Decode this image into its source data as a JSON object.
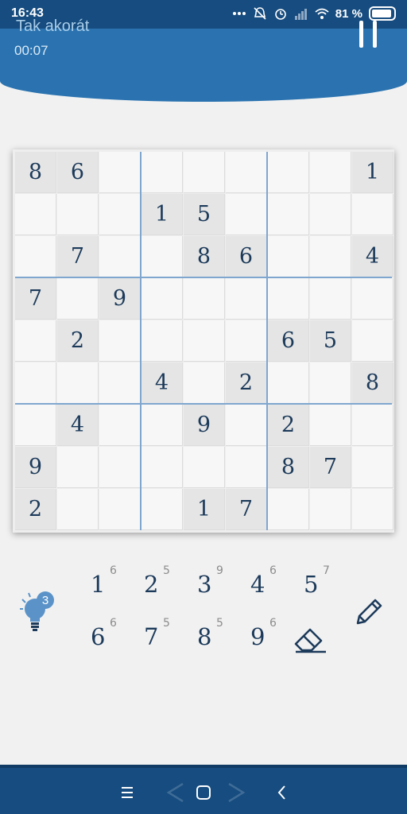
{
  "status_bar": {
    "time": "16:43",
    "battery": "81 %",
    "icons": [
      "dots-icon",
      "bell-off-icon",
      "alarm-icon",
      "signal-icon",
      "wifi-icon",
      "battery-icon"
    ]
  },
  "header": {
    "title": "Tak akorát",
    "timer": "00:07",
    "pause_icon": "pause-icon"
  },
  "board": {
    "grid": [
      [
        "8",
        "6",
        "",
        "",
        "",
        "",
        "",
        "",
        "1"
      ],
      [
        "",
        "",
        "",
        "1",
        "5",
        "",
        "",
        "",
        ""
      ],
      [
        "",
        "7",
        "",
        "",
        "8",
        "6",
        "",
        "",
        "4"
      ],
      [
        "7",
        "",
        "9",
        "",
        "",
        "",
        "",
        "",
        ""
      ],
      [
        "",
        "2",
        "",
        "",
        "",
        "",
        "6",
        "5",
        ""
      ],
      [
        "",
        "",
        "",
        "4",
        "",
        "2",
        "",
        "",
        "8"
      ],
      [
        "",
        "4",
        "",
        "",
        "9",
        "",
        "2",
        "",
        ""
      ],
      [
        "9",
        "",
        "",
        "",
        "",
        "",
        "8",
        "7",
        ""
      ],
      [
        "2",
        "",
        "",
        "",
        "1",
        "7",
        "",
        "",
        ""
      ]
    ]
  },
  "keypad": {
    "hints": "3",
    "numbers": [
      {
        "digit": "1",
        "count": "6"
      },
      {
        "digit": "2",
        "count": "5"
      },
      {
        "digit": "3",
        "count": "9"
      },
      {
        "digit": "4",
        "count": "6"
      },
      {
        "digit": "5",
        "count": "7"
      },
      {
        "digit": "6",
        "count": "6"
      },
      {
        "digit": "7",
        "count": "5"
      },
      {
        "digit": "8",
        "count": "5"
      },
      {
        "digit": "9",
        "count": "6"
      }
    ]
  },
  "colors": {
    "header": "#2a73b0",
    "status_bar": "#164c7f",
    "digit": "#1c3a5a",
    "box_line": "#7fa6cf",
    "hint_bulb": "#5b93c9"
  },
  "nav": {
    "icons": [
      "menu-icon",
      "back-arrow-icon",
      "home-icon",
      "forward-arrow-icon",
      "back-icon"
    ]
  }
}
